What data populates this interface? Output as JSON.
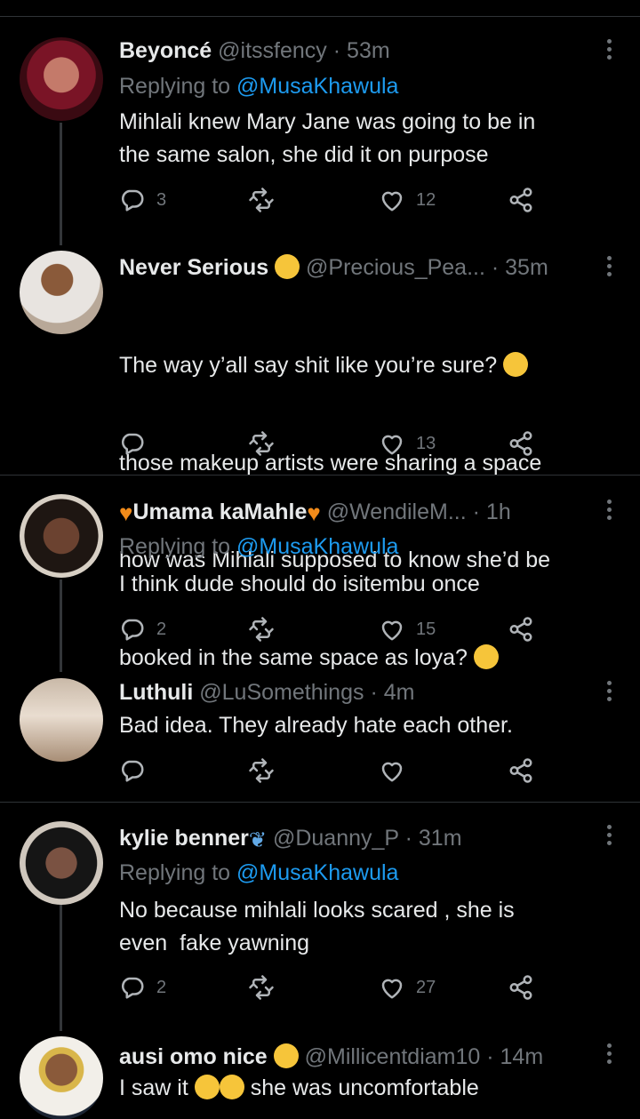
{
  "colors": {
    "background": "#000000",
    "text": "#e7e9ea",
    "muted": "#71767b",
    "link": "#1d9bf0"
  },
  "tweets": [
    {
      "name": "Beyoncé",
      "handle": "@itssfency",
      "time": "· 53m",
      "replying_prefix": "Replying to ",
      "replying_to": "@MusaKhawula",
      "text": "Mihlali knew Mary Jane was going to be in\nthe same salon, she did it on purpose",
      "replies": "3",
      "retweets": "",
      "likes": "12"
    },
    {
      "name": "Never Serious",
      "handle": "@Precious_Pea...",
      "time": "· 35m",
      "text_lines": [
        "The way y’all say shit like you’re sure?",
        "those makeup artists were sharing a space",
        "how was Mihlali supposed to know she’d be",
        "booked in the same space as loya?"
      ],
      "replies": "",
      "retweets": "",
      "likes": "13"
    },
    {
      "name": "Umama kaMahle",
      "handle": "@WendileM...",
      "time": "· 1h",
      "replying_prefix": "Replying to ",
      "replying_to": "@MusaKhawula",
      "text": "I think dude should do isitembu once",
      "replies": "2",
      "retweets": "",
      "likes": "15"
    },
    {
      "name": "Luthuli",
      "handle": "@LuSomethings",
      "time": "· 4m",
      "text": "Bad idea. They already hate each other.",
      "replies": "",
      "retweets": "",
      "likes": ""
    },
    {
      "name": "kylie benner",
      "handle": "@Duanny_P",
      "time": "· 31m",
      "replying_prefix": "Replying to ",
      "replying_to": "@MusaKhawula",
      "text": "No because mihlali looks scared , she is\neven  fake yawning",
      "replies": "2",
      "retweets": "",
      "likes": "27"
    },
    {
      "name": "ausi omo nice",
      "handle": "@Millicentdiam10",
      "time": "· 14m",
      "text_before": "I saw it ",
      "text_after": " she was uncomfortable"
    }
  ]
}
